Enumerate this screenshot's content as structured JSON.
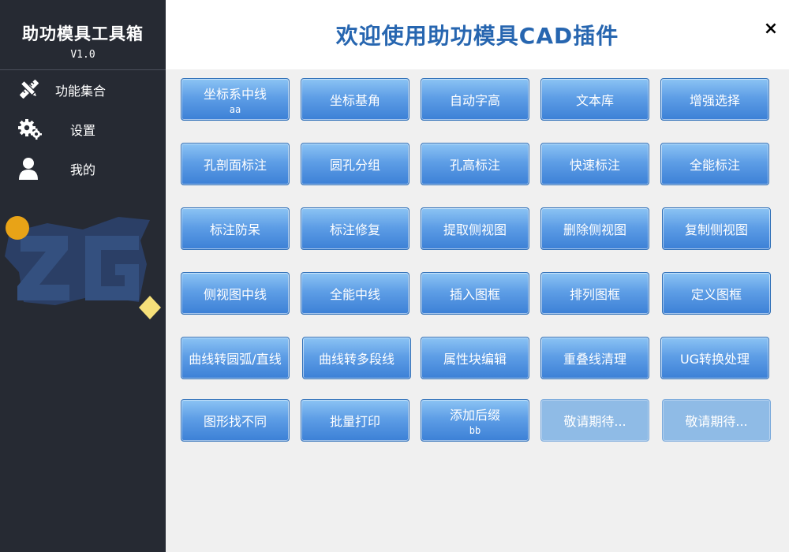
{
  "sidebar": {
    "title": "助功模具工具箱",
    "version": "V1.0",
    "nav": [
      {
        "label": "功能集合",
        "icon": "pencil-ruler-icon"
      },
      {
        "label": "设置",
        "icon": "gears-icon"
      },
      {
        "label": "我的",
        "icon": "user-icon"
      }
    ],
    "logo_text": "ZG"
  },
  "header": {
    "title": "欢迎使用助功模具CAD插件",
    "close_label": "×"
  },
  "colors": {
    "sidebar_bg": "#262a33",
    "accent": "#2766b0",
    "button_blue": "#4a8ce0",
    "disabled_blue": "#8fbbe6",
    "logo_orange": "#e8a317",
    "logo_yellow": "#f6e07a"
  },
  "buttons": [
    [
      {
        "label": "坐标系中线",
        "sub": "aa"
      },
      {
        "label": "坐标基角"
      },
      {
        "label": "自动字高"
      },
      {
        "label": "文本库"
      },
      {
        "label": "增强选择"
      }
    ],
    [
      {
        "label": "孔剖面标注"
      },
      {
        "label": "圆孔分组"
      },
      {
        "label": "孔高标注"
      },
      {
        "label": "快速标注"
      },
      {
        "label": "全能标注"
      }
    ],
    [
      {
        "label": "标注防呆"
      },
      {
        "label": "标注修复"
      },
      {
        "label": "提取侧视图"
      },
      {
        "label": "删除侧视图"
      },
      {
        "label": "复制侧视图"
      }
    ],
    [
      {
        "label": "侧视图中线"
      },
      {
        "label": "全能中线"
      },
      {
        "label": "插入图框"
      },
      {
        "label": "排列图框"
      },
      {
        "label": "定义图框"
      }
    ],
    [
      {
        "label": "曲线转圆弧/直线"
      },
      {
        "label": "曲线转多段线"
      },
      {
        "label": "属性块编辑"
      },
      {
        "label": "重叠线清理"
      },
      {
        "label": "UG转换处理"
      }
    ],
    [
      {
        "label": "图形找不同"
      },
      {
        "label": "批量打印"
      },
      {
        "label": "添加后缀",
        "sub": "bb"
      },
      {
        "label": "敬请期待...",
        "disabled": true
      },
      {
        "label": "敬请期待...",
        "disabled": true
      }
    ]
  ]
}
